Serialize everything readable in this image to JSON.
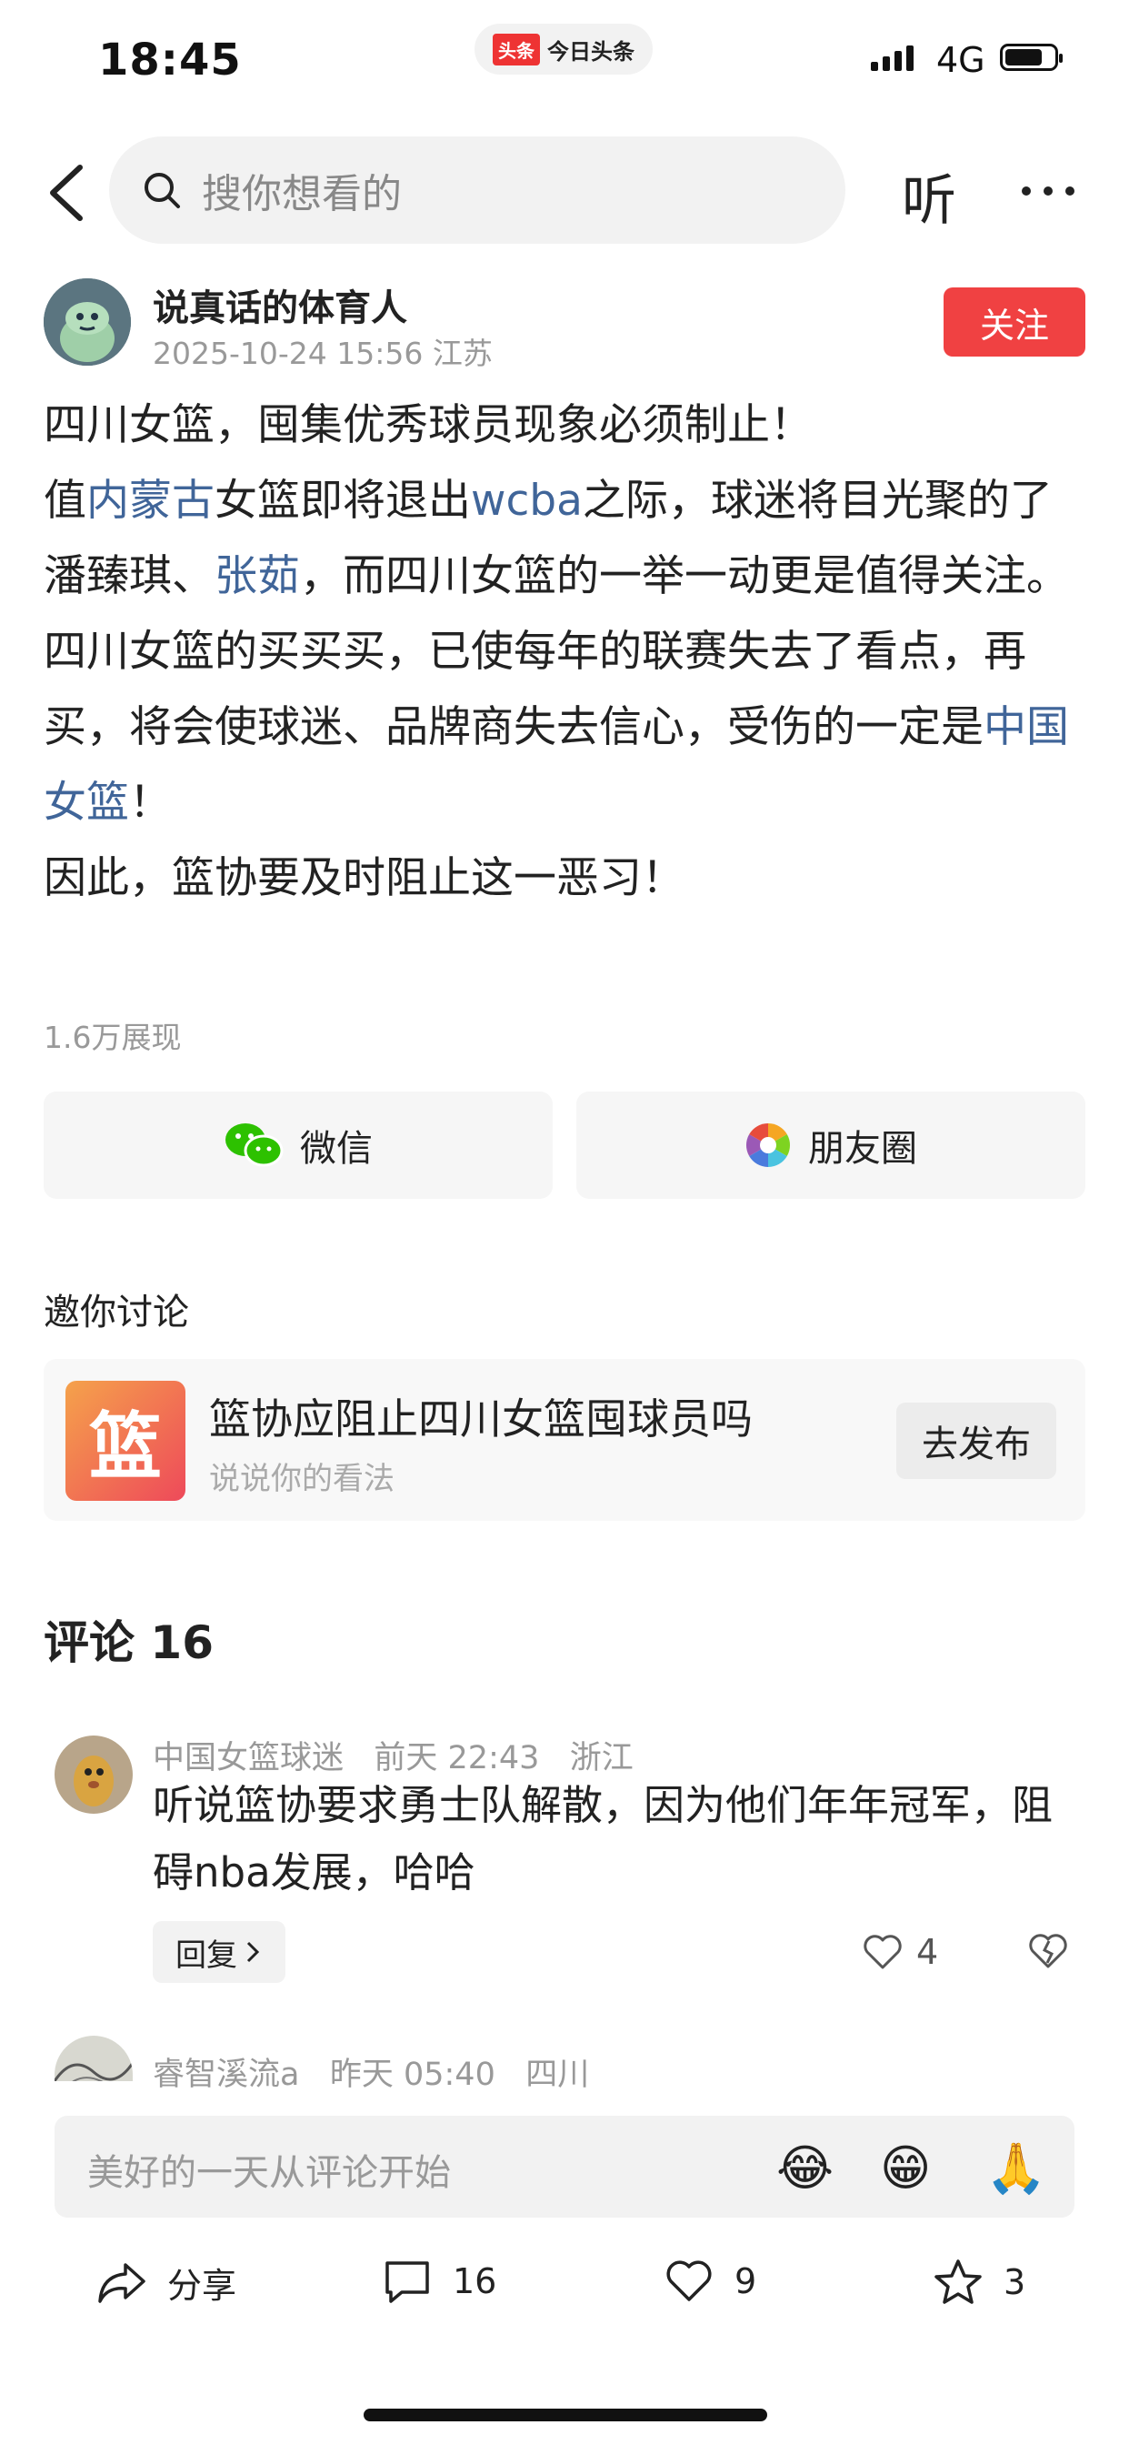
{
  "status_bar": {
    "time": "18:45",
    "app_logo": "头条",
    "app_name": "今日头条",
    "network": "4G",
    "icons": [
      "signal-icon",
      "battery-icon"
    ]
  },
  "nav": {
    "search_placeholder": "搜你想看的",
    "listen_label": "听",
    "icons": [
      "back-arrow-icon",
      "search-icon",
      "more-icon"
    ]
  },
  "author": {
    "name": "说真话的体育人",
    "meta": "2025-10-24 15:56  江苏",
    "follow_label": "关注"
  },
  "post": {
    "line1": "四川女篮，囤集优秀球员现象必须制止！",
    "p2_a": "值",
    "p2_link1": "内蒙古",
    "p2_b": "女篮即将退出",
    "p2_link2": "wcba",
    "p2_c": "之际，球迷将目光聚的了潘臻琪、",
    "p2_link3": "张茹",
    "p2_d": "，而四川女篮的一举一动更是值得关注。",
    "p3_a": "四川女篮的买买买，已使每年的联赛失去了看点，再买，将会使球迷、品牌商失去信心，受伤的一定是",
    "p3_link": "中国女篮",
    "p3_b": "！",
    "p4": "因此，篮协要及时阻止这一恶习！",
    "views": "1.6万展现",
    "link_color": "#406599"
  },
  "share": {
    "wechat_label": "微信",
    "moments_label": "朋友圈",
    "icons": [
      "wechat-icon",
      "moments-icon"
    ]
  },
  "invite": {
    "title": "邀你讨论",
    "topic_icon_char": "篮",
    "topic_title": "篮协应阻止四川女篮囤球员吗",
    "topic_sub": "说说你的看法",
    "publish_label": "去发布"
  },
  "comments": {
    "title": "评论 16",
    "items": [
      {
        "user": "中国女篮球迷",
        "time": "前天 22:43",
        "location": "浙江",
        "text": "听说篮协要求勇士队解散，因为他们年年冠军，阻碍nba发展，哈哈",
        "reply_label": "回复",
        "likes": "4"
      },
      {
        "user": "睿智溪流a",
        "time": "昨天 05:40",
        "location": "四川"
      }
    ]
  },
  "comment_input": {
    "placeholder": "美好的一天从评论开始",
    "emojis": [
      "😂",
      "😁",
      "🙏"
    ]
  },
  "bottom_bar": {
    "share_label": "分享",
    "comments_count": "16",
    "likes_count": "9",
    "favorites_count": "3",
    "icons": [
      "share-icon",
      "comment-icon",
      "heart-icon",
      "star-icon"
    ]
  },
  "colors": {
    "accent_red": "#f04142",
    "link_blue": "#406599"
  }
}
